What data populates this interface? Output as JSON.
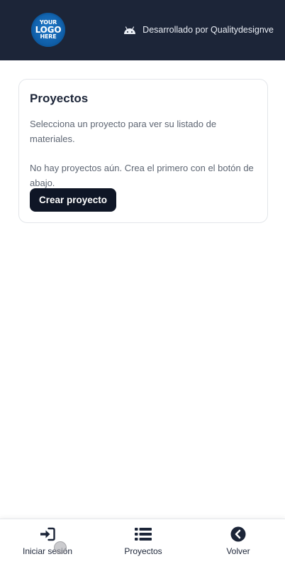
{
  "header": {
    "logo": {
      "line1": "YOUR",
      "line2": "LOGO",
      "line3": "HERE"
    },
    "developer_text": "Desarrollado por Qualitydesignve",
    "developer_icon": "android-icon"
  },
  "card": {
    "title": "Proyectos",
    "subtitle": "Selecciona un proyecto para ver su listado de materiales.",
    "empty_message": "No hay proyectos aún. Crea el primero con el botón de abajo.",
    "create_button": "Crear proyecto"
  },
  "bottom_nav": {
    "items": [
      {
        "label": "Iniciar sesión",
        "icon": "sign-in-icon"
      },
      {
        "label": "Proyectos",
        "icon": "list-icon"
      },
      {
        "label": "Volver",
        "icon": "chevron-left-circle-icon"
      }
    ]
  },
  "colors": {
    "header_bg": "#1c2538",
    "button_bg": "#0f1626",
    "text_muted": "#5e6673",
    "text_dark": "#1c2538"
  }
}
